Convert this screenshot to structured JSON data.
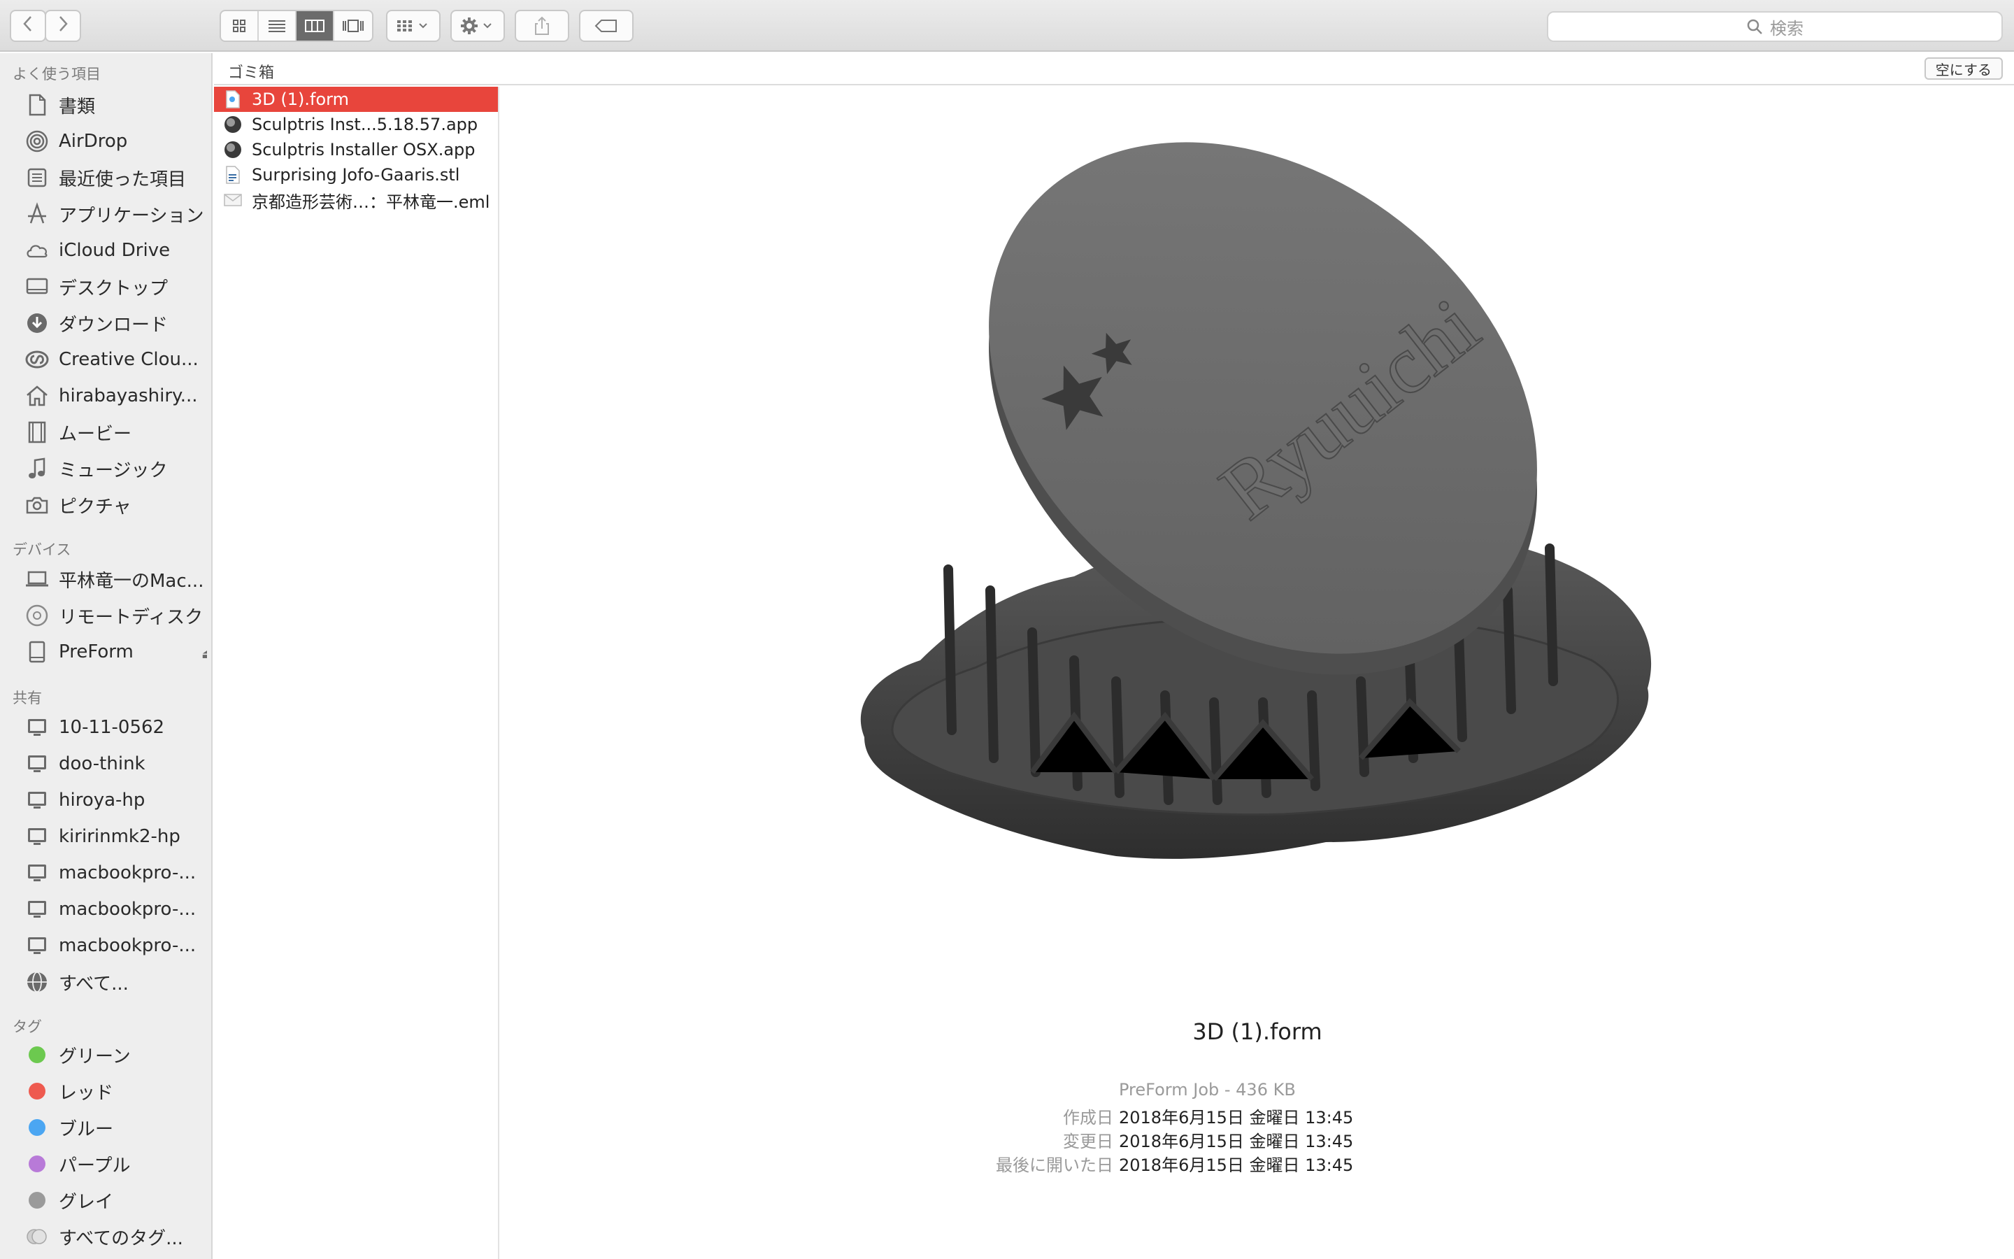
{
  "toolbar": {
    "back_icon": "chevron-left-icon",
    "forward_icon": "chevron-right-icon",
    "view_modes": [
      "icon-view",
      "list-view",
      "column-view",
      "gallery-view"
    ],
    "active_view": "column-view",
    "search_placeholder": "検索"
  },
  "sidebar": {
    "favorites_header": "よく使う項目",
    "favorites": [
      {
        "label": "書類",
        "icon": "document-icon"
      },
      {
        "label": "AirDrop",
        "icon": "airdrop-icon"
      },
      {
        "label": "最近使った項目",
        "icon": "recents-icon"
      },
      {
        "label": "アプリケーション",
        "icon": "applications-icon"
      },
      {
        "label": "iCloud Drive",
        "icon": "cloud-icon"
      },
      {
        "label": "デスクトップ",
        "icon": "desktop-icon"
      },
      {
        "label": "ダウンロード",
        "icon": "download-icon"
      },
      {
        "label": "Creative Clou...",
        "icon": "creative-cloud-icon"
      },
      {
        "label": "hirabayashiry...",
        "icon": "home-icon"
      },
      {
        "label": "ムービー",
        "icon": "film-icon"
      },
      {
        "label": "ミュージック",
        "icon": "music-icon"
      },
      {
        "label": "ピクチャ",
        "icon": "camera-icon"
      }
    ],
    "devices_header": "デバイス",
    "devices": [
      {
        "label": "平林竜一のMac...",
        "icon": "laptop-icon"
      },
      {
        "label": "リモートディスク",
        "icon": "disc-icon"
      },
      {
        "label": "PreForm",
        "icon": "drive-icon"
      }
    ],
    "shared_header": "共有",
    "shared": [
      {
        "label": "10-11-0562"
      },
      {
        "label": "doo-think"
      },
      {
        "label": "hiroya-hp"
      },
      {
        "label": "kiririnmk2-hp"
      },
      {
        "label": "macbookpro-..."
      },
      {
        "label": "macbookpro-..."
      },
      {
        "label": "macbookpro-..."
      },
      {
        "label": "すべて..."
      }
    ],
    "tags_header": "タグ",
    "tags": [
      {
        "label": "グリーン",
        "color": "#6cc94f"
      },
      {
        "label": "レッド",
        "color": "#ee5a4f"
      },
      {
        "label": "ブルー",
        "color": "#4ba6f2"
      },
      {
        "label": "パープル",
        "color": "#b87ad8"
      },
      {
        "label": "グレイ",
        "color": "#9a9a9a"
      },
      {
        "label": "すべてのタグ...",
        "color": "#cfcfcf"
      }
    ]
  },
  "column": {
    "title": "ゴミ箱",
    "empty_button": "空にする",
    "files": [
      {
        "name": "3D (1).form",
        "icon": "form-file-icon",
        "selected": true
      },
      {
        "name": "Sculptris Inst...5.18.57.app",
        "icon": "app-icon",
        "selected": false
      },
      {
        "name": "Sculptris Installer OSX.app",
        "icon": "app-icon",
        "selected": false
      },
      {
        "name": "Surprising Jofo-Gaaris.stl",
        "icon": "stl-file-icon",
        "selected": false
      },
      {
        "name": "京都造形芸術…：平林竜一.eml",
        "icon": "mail-icon",
        "selected": false
      }
    ]
  },
  "preview": {
    "model_text": "Ryuuichi",
    "title": "3D (1).form",
    "kind": "PreForm Job - 436 KB",
    "meta": [
      {
        "key": "作成日",
        "value": "2018年6月15日 金曜日 13:45"
      },
      {
        "key": "変更日",
        "value": "2018年6月15日 金曜日 13:45"
      },
      {
        "key": "最後に開いた日",
        "value": "2018年6月15日 金曜日 13:45"
      }
    ]
  }
}
